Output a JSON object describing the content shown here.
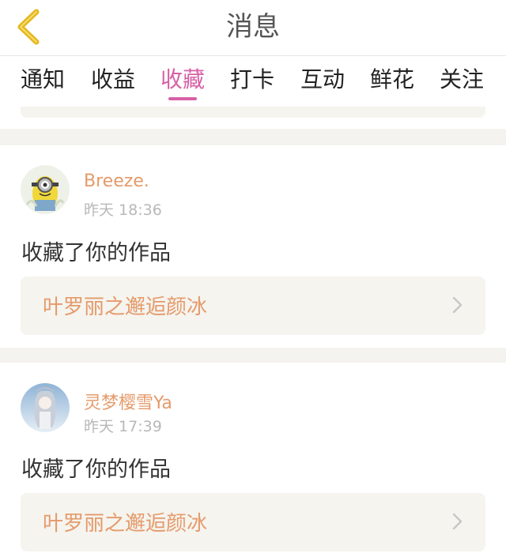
{
  "header": {
    "title": "消息",
    "back_icon": "chevron-left-icon",
    "accent": "#e5b71f"
  },
  "tabs": [
    {
      "label": "通知"
    },
    {
      "label": "收益"
    },
    {
      "label": "收藏",
      "active": true
    },
    {
      "label": "打卡"
    },
    {
      "label": "互动"
    },
    {
      "label": "鲜花"
    },
    {
      "label": "关注"
    }
  ],
  "active_color": "#d860a6",
  "messages": [
    {
      "username": "Breeze.",
      "time": "昨天 18:36",
      "action": "收藏了你的作品",
      "work_title": "叶罗丽之邂逅颜冰"
    },
    {
      "username": "灵梦樱雪Ya",
      "time": "昨天 17:39",
      "action": "收藏了你的作品",
      "work_title": "叶罗丽之邂逅颜冰"
    }
  ]
}
